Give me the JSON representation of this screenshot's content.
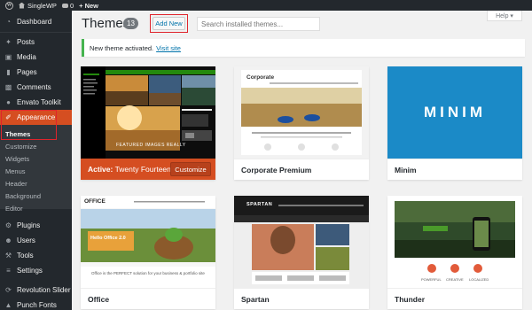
{
  "admin_bar": {
    "site_name": "SingleWP",
    "comments_count": "0",
    "new_label": "+ New"
  },
  "sidebar": {
    "items": [
      {
        "label": "Dashboard",
        "icon": "dashboard-icon"
      },
      {
        "label": "Posts",
        "icon": "pin-icon"
      },
      {
        "label": "Media",
        "icon": "media-icon"
      },
      {
        "label": "Pages",
        "icon": "pages-icon"
      },
      {
        "label": "Comments",
        "icon": "comments-icon"
      },
      {
        "label": "Envato Toolkit",
        "icon": "envato-icon"
      },
      {
        "label": "Appearance",
        "icon": "brush-icon"
      },
      {
        "label": "Plugins",
        "icon": "plugins-icon"
      },
      {
        "label": "Users",
        "icon": "users-icon"
      },
      {
        "label": "Tools",
        "icon": "tools-icon"
      },
      {
        "label": "Settings",
        "icon": "settings-icon"
      },
      {
        "label": "Revolution Slider",
        "icon": "slider-icon"
      },
      {
        "label": "Punch Fonts",
        "icon": "fonts-icon"
      }
    ],
    "submenu": [
      "Themes",
      "Customize",
      "Widgets",
      "Menus",
      "Header",
      "Background",
      "Editor"
    ]
  },
  "header": {
    "title": "Themes",
    "count": "13",
    "add_new": "Add New",
    "search_placeholder": "Search installed themes...",
    "help": "Help ▾"
  },
  "notice": {
    "text": "New theme activated.",
    "link": "Visit site"
  },
  "themes": [
    {
      "name": "Twenty Fourteen",
      "active_prefix": "Active:",
      "customize": "Customize",
      "caption": "FEATURED IMAGES REALLY"
    },
    {
      "name": "Corporate Premium",
      "brand": "Corporate"
    },
    {
      "name": "Minim",
      "logo": "MINIM"
    },
    {
      "name": "Office",
      "brand": "OFFICE",
      "slide": "Hello Office 2.0",
      "tagline": "Office is the PERFECT solution for your business & portfolio site"
    },
    {
      "name": "Spartan",
      "brand": "SPARTAN"
    },
    {
      "name": "Thunder",
      "features": [
        "POWERFUL",
        "CREATIVE",
        "LOCALIZED"
      ]
    }
  ],
  "colors": {
    "accent": "#d54e21",
    "sidebar": "#23282d",
    "link": "#0073aa",
    "highlight": "#e0242c",
    "notice": "#46b450"
  }
}
